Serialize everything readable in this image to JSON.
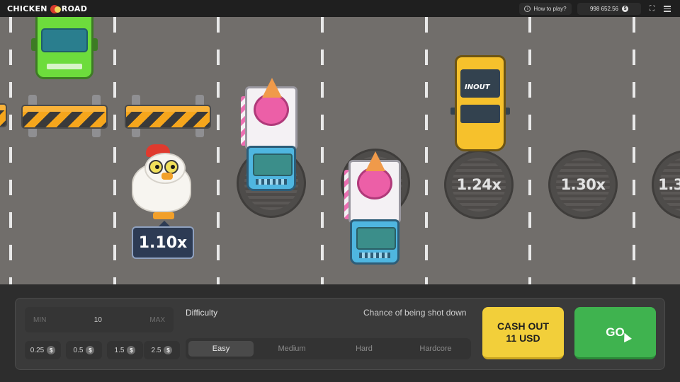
{
  "header": {
    "logo_text_1": "CHICKEN",
    "logo_text_2": "ROAD",
    "how_to_play": "How to play?",
    "balance": "998 652.56",
    "currency_symbol": "$",
    "icons": [
      "info-icon",
      "coin-icon",
      "fullscreen-icon",
      "menu-icon"
    ]
  },
  "game": {
    "current_multiplier": "1.10x",
    "upcoming_multipliers": [
      "1.24x",
      "1.30x",
      "1.3"
    ],
    "taxi_sign": "INOUT",
    "colors": {
      "road": "#716e6b",
      "green_truck": "#6ddc3c",
      "taxi": "#f6c12c",
      "ice_cream_scoop": "#ec5fa7",
      "badge": "#2d3b54"
    }
  },
  "controls": {
    "bet": {
      "min_label": "MIN",
      "value": "10",
      "max_label": "MAX"
    },
    "quick_bets": [
      "0.25",
      "0.5",
      "1.5",
      "2.5"
    ],
    "difficulty_label": "Difficulty",
    "chance_label": "Chance of being shot down",
    "difficulty_options": [
      "Easy",
      "Medium",
      "Hard",
      "Hardcore"
    ],
    "selected_difficulty": "Easy",
    "cashout_line1": "CASH OUT",
    "cashout_line2": "11 USD",
    "go_label": "GO",
    "colors": {
      "cashout": "#f2cf3a",
      "go": "#3fb34f"
    }
  }
}
